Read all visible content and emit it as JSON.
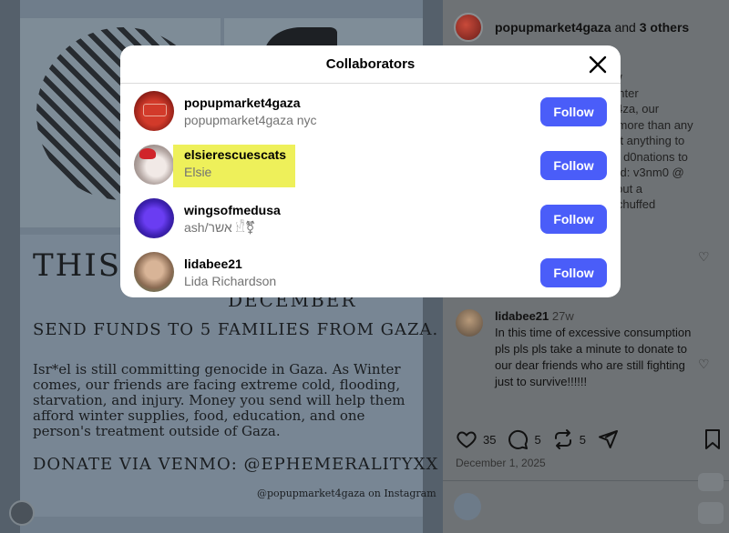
{
  "modal": {
    "title": "Collaborators",
    "close_label": "close",
    "collaborators": [
      {
        "username": "popupmarket4gaza",
        "fullname": "popupmarket4gaza nyc",
        "follow_label": "Follow",
        "highlighted": false
      },
      {
        "username": "elsierescuescats",
        "fullname": "Elsie",
        "follow_label": "Follow",
        "highlighted": true
      },
      {
        "username": "wingsofmedusa",
        "fullname": "ash/אשר 𓀺⚧",
        "follow_label": "Follow",
        "highlighted": false
      },
      {
        "username": "lidabee21",
        "fullname": "Lida Richardson",
        "follow_label": "Follow",
        "highlighted": false
      }
    ],
    "follow_color": "#4a5df9",
    "highlight_color": "#eef05a"
  },
  "post": {
    "header_owner": "popupmarket4gaza",
    "header_and": " and ",
    "header_others": "3 others",
    "caption_lines": [
      "7w",
      "winter",
      "G4za, our",
      "rt more than any",
      "got anything to",
      "ng d0nations to",
      "eed: v3nm0 @",
      "k out a",
      "e/chuffed"
    ],
    "comment": {
      "username": "lidabee21",
      "time": "27w",
      "text": "In this time of excessive consumption pls pls pls take a minute to donate to our dear friends who are still fighting just to survive!!!!!!"
    },
    "likes": "35",
    "comments": "5",
    "reposts": "5",
    "date": "December 1, 2025"
  },
  "poster": {
    "title": "THIS",
    "date_fragment": "DECEMBER",
    "send_line": "SEND FUNDS TO 5 FAMILIES FROM GAZA.",
    "body": "Isr*el is still committing genocide in Gaza. As Winter comes, our friends are facing extreme cold, flooding, starvation, and injury. Money you send will help them afford winter supplies, food, education, and one person's treatment outside of Gaza.",
    "donate_line": "DONATE VIA VENMO:  @EPHEMERALITYXX",
    "credit": "@popupmarket4gaza on Instagram"
  }
}
